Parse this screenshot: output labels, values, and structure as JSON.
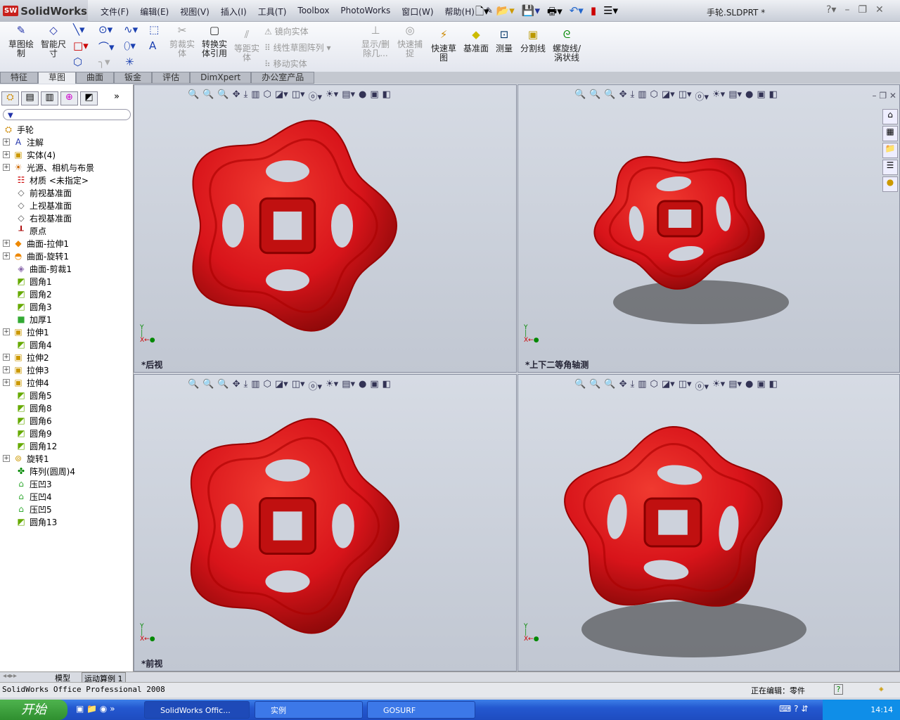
{
  "app": {
    "logo": "SolidWorks",
    "logo_badge": "SW",
    "doc_title": "手轮.SLDPRT *"
  },
  "menu": [
    "文件(F)",
    "编辑(E)",
    "视图(V)",
    "插入(I)",
    "工具(T)",
    "Toolbox",
    "PhotoWorks",
    "窗口(W)",
    "帮助(H)"
  ],
  "ribbon": {
    "sketch": "草图绘制",
    "smart_dim": "智能尺寸",
    "trim": "剪裁实体",
    "convert": "转换实体引用",
    "offset": "等距实体",
    "mirror": "镜向实体",
    "linear_pattern": "线性草图阵列",
    "move": "移动实体",
    "show_delete": "显示/删除几...",
    "quick_snap": "快速捕捉",
    "rapid_sketch": "快速草图",
    "plane": "基准面",
    "measure": "测量",
    "split_line": "分割线",
    "helix": "螺旋线/涡状线"
  },
  "tabs": [
    "特征",
    "草图",
    "曲面",
    "钣金",
    "评估",
    "DimXpert",
    "办公室产品"
  ],
  "active_tab": "草图",
  "tree": [
    {
      "label": "手轮",
      "icon": "part-icon",
      "exp": false,
      "root": true
    },
    {
      "label": "注解",
      "icon": "annotation-folder-icon",
      "exp": true
    },
    {
      "label": "实体(4)",
      "icon": "solid-bodies-folder-icon",
      "exp": true
    },
    {
      "label": "光源、相机与布景",
      "icon": "lights-folder-icon",
      "exp": true
    },
    {
      "label": "材质 <未指定>",
      "icon": "material-icon",
      "exp": false
    },
    {
      "label": "前视基准面",
      "icon": "plane-icon",
      "exp": false
    },
    {
      "label": "上视基准面",
      "icon": "plane-icon",
      "exp": false
    },
    {
      "label": "右视基准面",
      "icon": "plane-icon",
      "exp": false
    },
    {
      "label": "原点",
      "icon": "origin-icon",
      "exp": false
    },
    {
      "label": "曲面-拉伸1",
      "icon": "surface-extrude-icon",
      "exp": true
    },
    {
      "label": "曲面-旋转1",
      "icon": "surface-revolve-icon",
      "exp": true
    },
    {
      "label": "曲面-剪裁1",
      "icon": "surface-trim-icon",
      "exp": false
    },
    {
      "label": "圆角1",
      "icon": "fillet-icon",
      "exp": false
    },
    {
      "label": "圆角2",
      "icon": "fillet-icon",
      "exp": false
    },
    {
      "label": "圆角3",
      "icon": "fillet-icon",
      "exp": false
    },
    {
      "label": "加厚1",
      "icon": "thicken-icon",
      "exp": false
    },
    {
      "label": "拉伸1",
      "icon": "extrude-icon",
      "exp": true
    },
    {
      "label": "圆角4",
      "icon": "fillet-icon",
      "exp": false
    },
    {
      "label": "拉伸2",
      "icon": "extrude-icon",
      "exp": true
    },
    {
      "label": "拉伸3",
      "icon": "extrude-icon",
      "exp": true
    },
    {
      "label": "拉伸4",
      "icon": "extrude-icon",
      "exp": true
    },
    {
      "label": "圆角5",
      "icon": "fillet-icon",
      "exp": false
    },
    {
      "label": "圆角8",
      "icon": "fillet-icon",
      "exp": false
    },
    {
      "label": "圆角6",
      "icon": "fillet-icon",
      "exp": false
    },
    {
      "label": "圆角9",
      "icon": "fillet-icon",
      "exp": false
    },
    {
      "label": "圆角12",
      "icon": "fillet-icon",
      "exp": false
    },
    {
      "label": "旋转1",
      "icon": "revolve-icon",
      "exp": true
    },
    {
      "label": "阵列(圆周)4",
      "icon": "circular-pattern-icon",
      "exp": false
    },
    {
      "label": "压凹3",
      "icon": "indent-icon",
      "exp": false
    },
    {
      "label": "压凹4",
      "icon": "indent-icon",
      "exp": false
    },
    {
      "label": "压凹5",
      "icon": "indent-icon",
      "exp": false
    },
    {
      "label": "圆角13",
      "icon": "fillet-icon",
      "exp": false
    }
  ],
  "viewports": [
    {
      "label": "*后视"
    },
    {
      "label": "*上下二等角轴测"
    },
    {
      "label": "*前视"
    },
    {
      "label": ""
    }
  ],
  "bottom_tabs": [
    "模型",
    "运动算例 1"
  ],
  "status": {
    "product": "SolidWorks Office Professional 2008",
    "editing": "正在编辑：零件"
  },
  "taskbar": {
    "start": "开始",
    "tasks": [
      "SolidWorks Offic...",
      "实例",
      "GOSURF"
    ],
    "clock": "14:14"
  },
  "colors": {
    "part_red": "#d8141a",
    "taskbar": "#2458d0"
  }
}
